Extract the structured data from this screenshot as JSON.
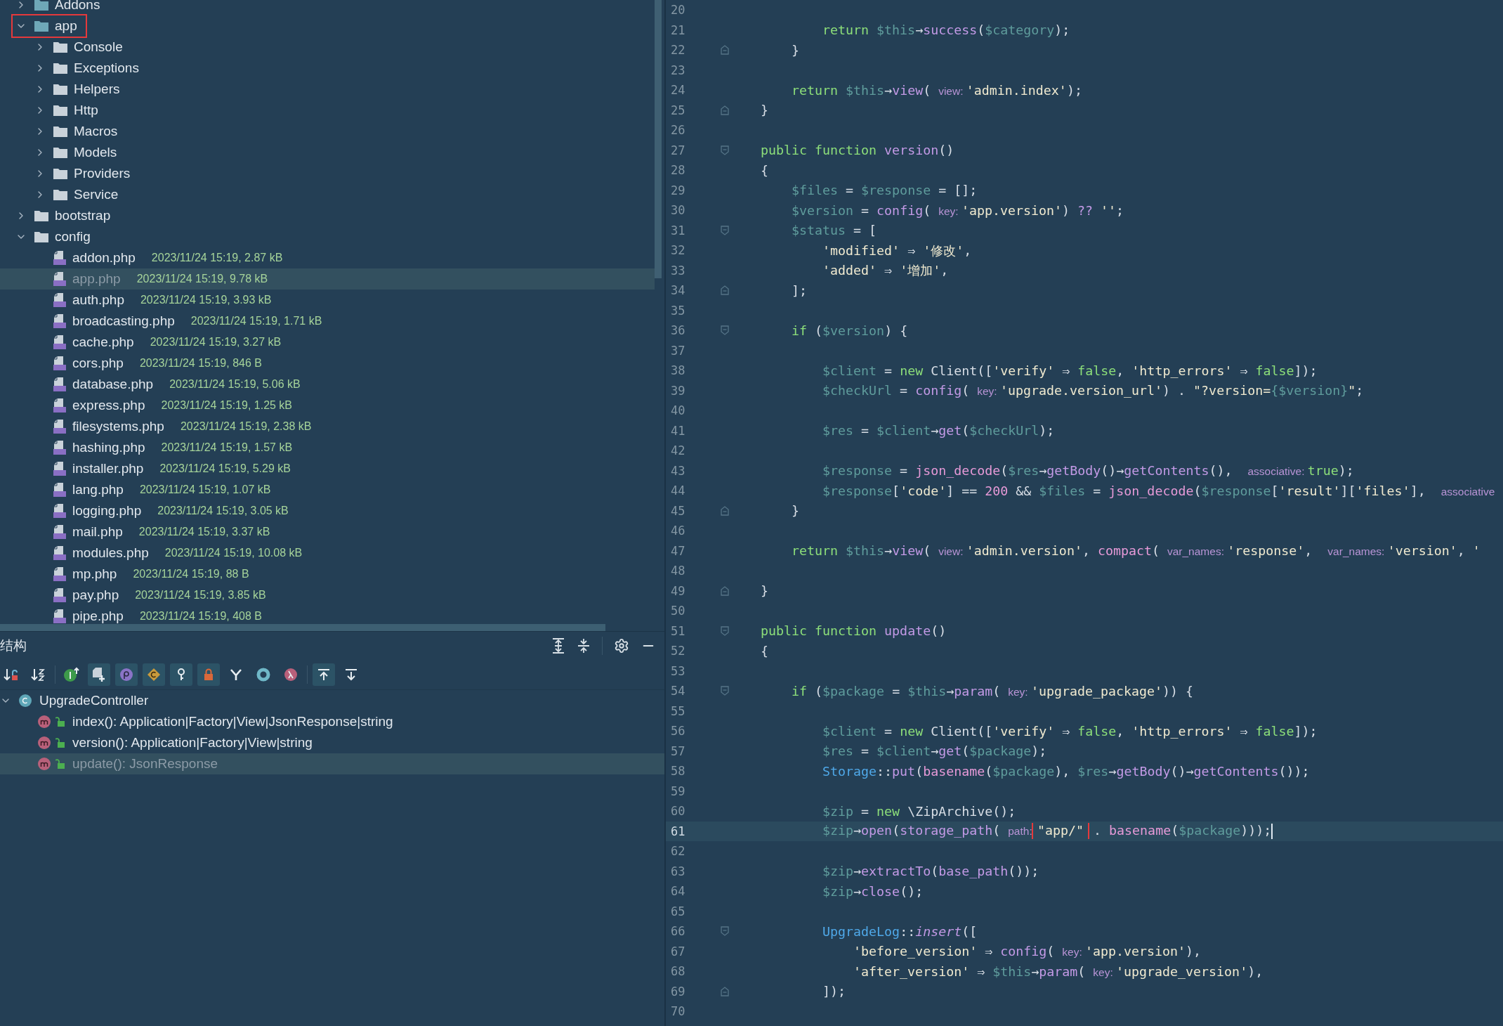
{
  "project_tree": {
    "items": [
      {
        "kind": "source-folder",
        "name": "Addons",
        "expanded": false,
        "selected": false,
        "highlighted": false
      },
      {
        "kind": "source-folder",
        "name": "app",
        "expanded": true,
        "selected": false,
        "highlighted": true,
        "children": [
          {
            "kind": "folder",
            "name": "Console",
            "expanded": false,
            "selected": false
          },
          {
            "kind": "folder",
            "name": "Exceptions",
            "expanded": false,
            "selected": false
          },
          {
            "kind": "folder",
            "name": "Helpers",
            "expanded": false,
            "selected": false
          },
          {
            "kind": "folder",
            "name": "Http",
            "expanded": false,
            "selected": false
          },
          {
            "kind": "folder",
            "name": "Macros",
            "expanded": false,
            "selected": false
          },
          {
            "kind": "folder",
            "name": "Models",
            "expanded": false,
            "selected": false
          },
          {
            "kind": "folder",
            "name": "Providers",
            "expanded": false,
            "selected": false
          },
          {
            "kind": "folder",
            "name": "Service",
            "expanded": false,
            "selected": false
          }
        ]
      },
      {
        "kind": "folder",
        "name": "bootstrap",
        "expanded": false,
        "selected": false
      },
      {
        "kind": "folder",
        "name": "config",
        "expanded": true,
        "selected": false,
        "children": [
          {
            "kind": "file",
            "name": "addon.php",
            "meta": "2023/11/24 15:19, 2.87 kB",
            "selected": false
          },
          {
            "kind": "file",
            "name": "app.php",
            "meta": "2023/11/24 15:19, 9.78 kB",
            "selected": true
          },
          {
            "kind": "file",
            "name": "auth.php",
            "meta": "2023/11/24 15:19, 3.93 kB",
            "selected": false
          },
          {
            "kind": "file",
            "name": "broadcasting.php",
            "meta": "2023/11/24 15:19, 1.71 kB",
            "selected": false
          },
          {
            "kind": "file",
            "name": "cache.php",
            "meta": "2023/11/24 15:19, 3.27 kB",
            "selected": false
          },
          {
            "kind": "file",
            "name": "cors.php",
            "meta": "2023/11/24 15:19, 846 B",
            "selected": false
          },
          {
            "kind": "file",
            "name": "database.php",
            "meta": "2023/11/24 15:19, 5.06 kB",
            "selected": false
          },
          {
            "kind": "file",
            "name": "express.php",
            "meta": "2023/11/24 15:19, 1.25 kB",
            "selected": false
          },
          {
            "kind": "file",
            "name": "filesystems.php",
            "meta": "2023/11/24 15:19, 2.38 kB",
            "selected": false
          },
          {
            "kind": "file",
            "name": "hashing.php",
            "meta": "2023/11/24 15:19, 1.57 kB",
            "selected": false
          },
          {
            "kind": "file",
            "name": "installer.php",
            "meta": "2023/11/24 15:19, 5.29 kB",
            "selected": false
          },
          {
            "kind": "file",
            "name": "lang.php",
            "meta": "2023/11/24 15:19, 1.07 kB",
            "selected": false
          },
          {
            "kind": "file",
            "name": "logging.php",
            "meta": "2023/11/24 15:19, 3.05 kB",
            "selected": false
          },
          {
            "kind": "file",
            "name": "mail.php",
            "meta": "2023/11/24 15:19, 3.37 kB",
            "selected": false
          },
          {
            "kind": "file",
            "name": "modules.php",
            "meta": "2023/11/24 15:19, 10.08 kB",
            "selected": false
          },
          {
            "kind": "file",
            "name": "mp.php",
            "meta": "2023/11/24 15:19, 88 B",
            "selected": false
          },
          {
            "kind": "file",
            "name": "pay.php",
            "meta": "2023/11/24 15:19, 3.85 kB",
            "selected": false
          },
          {
            "kind": "file",
            "name": "pipe.php",
            "meta": "2023/11/24 15:19, 408 B",
            "selected": false
          }
        ]
      }
    ]
  },
  "structure": {
    "title": "结构",
    "toolbar": [
      {
        "kind": "sort-visibility",
        "selected": false
      },
      {
        "kind": "sort-alpha",
        "selected": false
      },
      {
        "kind": "inherited",
        "selected": false
      },
      {
        "kind": "anonymous",
        "selected": true
      },
      {
        "kind": "properties",
        "selected": true
      },
      {
        "kind": "constants",
        "selected": true
      },
      {
        "kind": "keys",
        "selected": true
      },
      {
        "kind": "private",
        "selected": true
      },
      {
        "kind": "branch",
        "selected": false
      },
      {
        "kind": "ring",
        "selected": false
      },
      {
        "kind": "lambda",
        "selected": false
      },
      {
        "kind": "scroll-to",
        "selected": true
      },
      {
        "kind": "scroll-from",
        "selected": false
      }
    ],
    "items": [
      {
        "kind": "class",
        "name": "UpgradeController",
        "expanded": true,
        "selected": false,
        "children": [
          {
            "kind": "method",
            "name": "index(): Application|Factory|View|JsonResponse|string",
            "selected": false
          },
          {
            "kind": "method",
            "name": "version(): Application|Factory|View|string",
            "selected": false
          },
          {
            "kind": "method",
            "name": "update(): JsonResponse",
            "selected": true
          }
        ]
      }
    ]
  },
  "editor": {
    "lines": [
      {
        "number": "20"
      },
      {
        "number": "21",
        "tokens": [
          {
            "kind": "kw",
            "text": "        return "
          },
          {
            "kind": "var",
            "text": "$this"
          },
          {
            "kind": "p",
            "text": "→"
          },
          {
            "kind": "m",
            "text": "success"
          },
          {
            "kind": "p",
            "text": "("
          },
          {
            "kind": "var",
            "text": "$category"
          },
          {
            "kind": "p",
            "text": ");"
          }
        ]
      },
      {
        "number": "22",
        "fold_close": true,
        "tokens": [
          {
            "kind": "p",
            "text": "    }"
          }
        ]
      },
      {
        "number": "23"
      },
      {
        "number": "24",
        "tokens": [
          {
            "kind": "kw",
            "text": "    return "
          },
          {
            "kind": "var",
            "text": "$this"
          },
          {
            "kind": "p",
            "text": "→"
          },
          {
            "kind": "m",
            "text": "view"
          },
          {
            "kind": "p",
            "text": "( "
          },
          {
            "kind": "hint",
            "text": "view: "
          },
          {
            "kind": "str",
            "text": "'admin.index'"
          },
          {
            "kind": "p",
            "text": ");"
          }
        ]
      },
      {
        "number": "25",
        "fold_close": true,
        "tokens": [
          {
            "kind": "p",
            "text": "}"
          }
        ]
      },
      {
        "number": "26"
      },
      {
        "number": "27",
        "fold_open": true,
        "tokens": [
          {
            "kind": "kw",
            "text": "public function "
          },
          {
            "kind": "m",
            "text": "version"
          },
          {
            "kind": "p",
            "text": "()"
          }
        ]
      },
      {
        "number": "28",
        "tokens": [
          {
            "kind": "p",
            "text": "{"
          }
        ]
      },
      {
        "number": "29",
        "tokens": [
          {
            "kind": "var",
            "text": "    $files"
          },
          {
            "kind": "p",
            "text": " = "
          },
          {
            "kind": "var",
            "text": "$response"
          },
          {
            "kind": "p",
            "text": " = [];"
          }
        ]
      },
      {
        "number": "30",
        "tokens": [
          {
            "kind": "var",
            "text": "    $version"
          },
          {
            "kind": "p",
            "text": " = "
          },
          {
            "kind": "m",
            "text": "config"
          },
          {
            "kind": "p",
            "text": "( "
          },
          {
            "kind": "hint",
            "text": "key: "
          },
          {
            "kind": "str",
            "text": "'app.version'"
          },
          {
            "kind": "p",
            "text": ") "
          },
          {
            "kind": "m",
            "text": "??"
          },
          {
            "kind": "str",
            "text": " ''"
          },
          {
            "kind": "p",
            "text": ";"
          }
        ]
      },
      {
        "number": "31",
        "fold_open": true,
        "tokens": [
          {
            "kind": "var",
            "text": "    $status"
          },
          {
            "kind": "p",
            "text": " = ["
          }
        ]
      },
      {
        "number": "32",
        "tokens": [
          {
            "kind": "str",
            "text": "        'modified'"
          },
          {
            "kind": "p",
            "text": " ⇒ "
          },
          {
            "kind": "str",
            "text": "'修改'"
          },
          {
            "kind": "p",
            "text": ","
          }
        ]
      },
      {
        "number": "33",
        "tokens": [
          {
            "kind": "str",
            "text": "        'added'"
          },
          {
            "kind": "p",
            "text": " ⇒ "
          },
          {
            "kind": "str",
            "text": "'增加'"
          },
          {
            "kind": "p",
            "text": ","
          }
        ]
      },
      {
        "number": "34",
        "fold_close": true,
        "tokens": [
          {
            "kind": "p",
            "text": "    ];"
          }
        ]
      },
      {
        "number": "35"
      },
      {
        "number": "36",
        "fold_open": true,
        "tokens": [
          {
            "kind": "kw",
            "text": "    if"
          },
          {
            "kind": "p",
            "text": " ("
          },
          {
            "kind": "var",
            "text": "$version"
          },
          {
            "kind": "p",
            "text": ") {"
          }
        ]
      },
      {
        "number": "37"
      },
      {
        "number": "38",
        "tokens": [
          {
            "kind": "var",
            "text": "        $client"
          },
          {
            "kind": "p",
            "text": " = "
          },
          {
            "kind": "kw",
            "text": "new"
          },
          {
            "kind": "p",
            "text": " Client(["
          },
          {
            "kind": "str",
            "text": "'verify'"
          },
          {
            "kind": "p",
            "text": " ⇒ "
          },
          {
            "kind": "kw",
            "text": "false"
          },
          {
            "kind": "p",
            "text": ", "
          },
          {
            "kind": "str",
            "text": "'http_errors'"
          },
          {
            "kind": "p",
            "text": " ⇒ "
          },
          {
            "kind": "kw",
            "text": "false"
          },
          {
            "kind": "p",
            "text": "]);"
          }
        ]
      },
      {
        "number": "39",
        "tokens": [
          {
            "kind": "var",
            "text": "        $checkUrl"
          },
          {
            "kind": "p",
            "text": " = "
          },
          {
            "kind": "m",
            "text": "config"
          },
          {
            "kind": "p",
            "text": "( "
          },
          {
            "kind": "hint",
            "text": "key: "
          },
          {
            "kind": "str",
            "text": "'upgrade.version_url'"
          },
          {
            "kind": "p",
            "text": ") . "
          },
          {
            "kind": "str",
            "text": "\"?version="
          },
          {
            "kind": "var",
            "text": "{$version}"
          },
          {
            "kind": "str",
            "text": "\""
          },
          {
            "kind": "p",
            "text": ";"
          }
        ]
      },
      {
        "number": "40"
      },
      {
        "number": "41",
        "tokens": [
          {
            "kind": "var",
            "text": "        $res"
          },
          {
            "kind": "p",
            "text": " = "
          },
          {
            "kind": "var",
            "text": "$client"
          },
          {
            "kind": "p",
            "text": "→"
          },
          {
            "kind": "m",
            "text": "get",
            "wavy": true
          },
          {
            "kind": "p",
            "text": "("
          },
          {
            "kind": "var",
            "text": "$checkUrl"
          },
          {
            "kind": "p",
            "text": ");"
          }
        ]
      },
      {
        "number": "42"
      },
      {
        "number": "43",
        "tokens": [
          {
            "kind": "var",
            "text": "        $response"
          },
          {
            "kind": "p",
            "text": " = "
          },
          {
            "kind": "fn",
            "text": "json_decode"
          },
          {
            "kind": "p",
            "text": "("
          },
          {
            "kind": "var",
            "text": "$res"
          },
          {
            "kind": "p",
            "text": "→"
          },
          {
            "kind": "m",
            "text": "getBody"
          },
          {
            "kind": "p",
            "text": "()→"
          },
          {
            "kind": "m",
            "text": "getContents"
          },
          {
            "kind": "p",
            "text": "(),  "
          },
          {
            "kind": "hint",
            "text": "associative: "
          },
          {
            "kind": "kw",
            "text": "true"
          },
          {
            "kind": "p",
            "text": ");"
          }
        ]
      },
      {
        "number": "44",
        "tokens": [
          {
            "kind": "var",
            "text": "        $response"
          },
          {
            "kind": "p",
            "text": "["
          },
          {
            "kind": "str",
            "text": "'code'"
          },
          {
            "kind": "p",
            "text": "] == "
          },
          {
            "kind": "num",
            "text": "200"
          },
          {
            "kind": "p",
            "text": " && "
          },
          {
            "kind": "var",
            "text": "$files"
          },
          {
            "kind": "p",
            "text": " = "
          },
          {
            "kind": "fn",
            "text": "json_decode"
          },
          {
            "kind": "p",
            "text": "("
          },
          {
            "kind": "var",
            "text": "$response"
          },
          {
            "kind": "p",
            "text": "["
          },
          {
            "kind": "str",
            "text": "'result'"
          },
          {
            "kind": "p",
            "text": "]["
          },
          {
            "kind": "str",
            "text": "'files'"
          },
          {
            "kind": "p",
            "text": "],  "
          },
          {
            "kind": "hint",
            "text": "associative"
          }
        ]
      },
      {
        "number": "45",
        "fold_close": true,
        "tokens": [
          {
            "kind": "p",
            "text": "    }"
          }
        ]
      },
      {
        "number": "46"
      },
      {
        "number": "47",
        "tokens": [
          {
            "kind": "kw",
            "text": "    return "
          },
          {
            "kind": "var",
            "text": "$this"
          },
          {
            "kind": "p",
            "text": "→"
          },
          {
            "kind": "m",
            "text": "view"
          },
          {
            "kind": "p",
            "text": "( "
          },
          {
            "kind": "hint",
            "text": "view: "
          },
          {
            "kind": "str",
            "text": "'admin.version'"
          },
          {
            "kind": "p",
            "text": ", "
          },
          {
            "kind": "fn",
            "text": "compact"
          },
          {
            "kind": "p",
            "text": "( "
          },
          {
            "kind": "hint",
            "text": "var_names: "
          },
          {
            "kind": "str",
            "text": "'response'"
          },
          {
            "kind": "p",
            "text": ",  "
          },
          {
            "kind": "hint",
            "text": "var_names: "
          },
          {
            "kind": "str",
            "text": "'version'"
          },
          {
            "kind": "p",
            "text": ", "
          },
          {
            "kind": "str",
            "text": "'"
          }
        ]
      },
      {
        "number": "48"
      },
      {
        "number": "49",
        "fold_close": true,
        "tokens": [
          {
            "kind": "p",
            "text": "}"
          }
        ]
      },
      {
        "number": "50"
      },
      {
        "number": "51",
        "fold_open": true,
        "tokens": [
          {
            "kind": "kw",
            "text": "public function "
          },
          {
            "kind": "m",
            "text": "update",
            "wavy": true
          },
          {
            "kind": "p",
            "text": "()"
          }
        ]
      },
      {
        "number": "52",
        "tokens": [
          {
            "kind": "p",
            "text": "{"
          }
        ]
      },
      {
        "number": "53"
      },
      {
        "number": "54",
        "fold_open": true,
        "tokens": [
          {
            "kind": "kw",
            "text": "    if"
          },
          {
            "kind": "p",
            "text": " ("
          },
          {
            "kind": "var",
            "text": "$package"
          },
          {
            "kind": "p",
            "text": " = "
          },
          {
            "kind": "var",
            "text": "$this"
          },
          {
            "kind": "p",
            "text": "→"
          },
          {
            "kind": "m",
            "text": "param"
          },
          {
            "kind": "p",
            "text": "( "
          },
          {
            "kind": "hint",
            "text": "key: "
          },
          {
            "kind": "str",
            "text": "'upgrade_package'"
          },
          {
            "kind": "p",
            "text": ")) {"
          }
        ]
      },
      {
        "number": "55"
      },
      {
        "number": "56",
        "tokens": [
          {
            "kind": "var",
            "text": "        $client"
          },
          {
            "kind": "p",
            "text": " = "
          },
          {
            "kind": "kw",
            "text": "new"
          },
          {
            "kind": "p",
            "text": " Client(["
          },
          {
            "kind": "str",
            "text": "'verify'"
          },
          {
            "kind": "p",
            "text": " ⇒ "
          },
          {
            "kind": "kw",
            "text": "false"
          },
          {
            "kind": "p",
            "text": ", "
          },
          {
            "kind": "str",
            "text": "'http_errors'"
          },
          {
            "kind": "p",
            "text": " ⇒ "
          },
          {
            "kind": "kw",
            "text": "false"
          },
          {
            "kind": "p",
            "text": "]);"
          }
        ]
      },
      {
        "number": "57",
        "tokens": [
          {
            "kind": "var",
            "text": "        $res"
          },
          {
            "kind": "p",
            "text": " = "
          },
          {
            "kind": "var",
            "text": "$client"
          },
          {
            "kind": "p",
            "text": "→"
          },
          {
            "kind": "m",
            "text": "get",
            "wavy": true
          },
          {
            "kind": "p",
            "text": "("
          },
          {
            "kind": "var",
            "text": "$package"
          },
          {
            "kind": "p",
            "text": ");"
          }
        ]
      },
      {
        "number": "58",
        "tokens": [
          {
            "kind": "cls",
            "text": "        Storage"
          },
          {
            "kind": "p",
            "text": "::"
          },
          {
            "kind": "m",
            "text": "put"
          },
          {
            "kind": "p",
            "text": "("
          },
          {
            "kind": "fn",
            "text": "basename"
          },
          {
            "kind": "p",
            "text": "("
          },
          {
            "kind": "var",
            "text": "$package"
          },
          {
            "kind": "p",
            "text": "), "
          },
          {
            "kind": "var",
            "text": "$res"
          },
          {
            "kind": "p",
            "text": "→"
          },
          {
            "kind": "m",
            "text": "getBody"
          },
          {
            "kind": "p",
            "text": "()→"
          },
          {
            "kind": "m",
            "text": "getContents"
          },
          {
            "kind": "p",
            "text": "());"
          }
        ]
      },
      {
        "number": "59"
      },
      {
        "number": "60",
        "tokens": [
          {
            "kind": "var",
            "text": "        $zip"
          },
          {
            "kind": "p",
            "text": " = "
          },
          {
            "kind": "kw",
            "text": "new"
          },
          {
            "kind": "p",
            "text": " \\ZipArchive();"
          }
        ]
      },
      {
        "number": "61",
        "current": true,
        "tokens": [
          {
            "kind": "var",
            "text": "        $zip"
          },
          {
            "kind": "p",
            "text": "→"
          },
          {
            "kind": "m",
            "text": "open"
          },
          {
            "kind": "p",
            "text": "("
          },
          {
            "kind": "m",
            "text": "storage_path"
          },
          {
            "kind": "p",
            "text": "( "
          },
          {
            "kind": "hint",
            "text": "path: "
          },
          {
            "kind": "str",
            "text": "\"app/\"",
            "boxed": true
          },
          {
            "kind": "p",
            "text": " . "
          },
          {
            "kind": "fn",
            "text": "basename"
          },
          {
            "kind": "p",
            "text": "("
          },
          {
            "kind": "var",
            "text": "$package"
          },
          {
            "kind": "p",
            "text": ")));"
          }
        ]
      },
      {
        "number": "62"
      },
      {
        "number": "63",
        "tokens": [
          {
            "kind": "var",
            "text": "        $zip"
          },
          {
            "kind": "p",
            "text": "→"
          },
          {
            "kind": "m",
            "text": "extractTo"
          },
          {
            "kind": "p",
            "text": "("
          },
          {
            "kind": "m",
            "text": "base_path"
          },
          {
            "kind": "p",
            "text": "());"
          }
        ]
      },
      {
        "number": "64",
        "tokens": [
          {
            "kind": "var",
            "text": "        $zip"
          },
          {
            "kind": "p",
            "text": "→"
          },
          {
            "kind": "m",
            "text": "close"
          },
          {
            "kind": "p",
            "text": "();"
          }
        ]
      },
      {
        "number": "65"
      },
      {
        "number": "66",
        "fold_open": true,
        "tokens": [
          {
            "kind": "cls",
            "text": "        UpgradeLog"
          },
          {
            "kind": "p",
            "text": "::"
          },
          {
            "kind": "m",
            "text": "insert",
            "italic": true
          },
          {
            "kind": "p",
            "text": "(["
          }
        ]
      },
      {
        "number": "67",
        "tokens": [
          {
            "kind": "str",
            "text": "            'before_version'"
          },
          {
            "kind": "p",
            "text": " ⇒ "
          },
          {
            "kind": "m",
            "text": "config"
          },
          {
            "kind": "p",
            "text": "( "
          },
          {
            "kind": "hint",
            "text": "key: "
          },
          {
            "kind": "str",
            "text": "'app.version'"
          },
          {
            "kind": "p",
            "text": "),"
          }
        ]
      },
      {
        "number": "68",
        "tokens": [
          {
            "kind": "str",
            "text": "            'after_version'"
          },
          {
            "kind": "p",
            "text": " ⇒ "
          },
          {
            "kind": "var",
            "text": "$this"
          },
          {
            "kind": "p",
            "text": "→"
          },
          {
            "kind": "m",
            "text": "param"
          },
          {
            "kind": "p",
            "text": "( "
          },
          {
            "kind": "hint",
            "text": "key: "
          },
          {
            "kind": "str",
            "text": "'upgrade_version'"
          },
          {
            "kind": "p",
            "text": "),"
          }
        ]
      },
      {
        "number": "69",
        "fold_close": true,
        "tokens": [
          {
            "kind": "p",
            "text": "        ]);"
          }
        ]
      },
      {
        "number": "70"
      }
    ]
  }
}
